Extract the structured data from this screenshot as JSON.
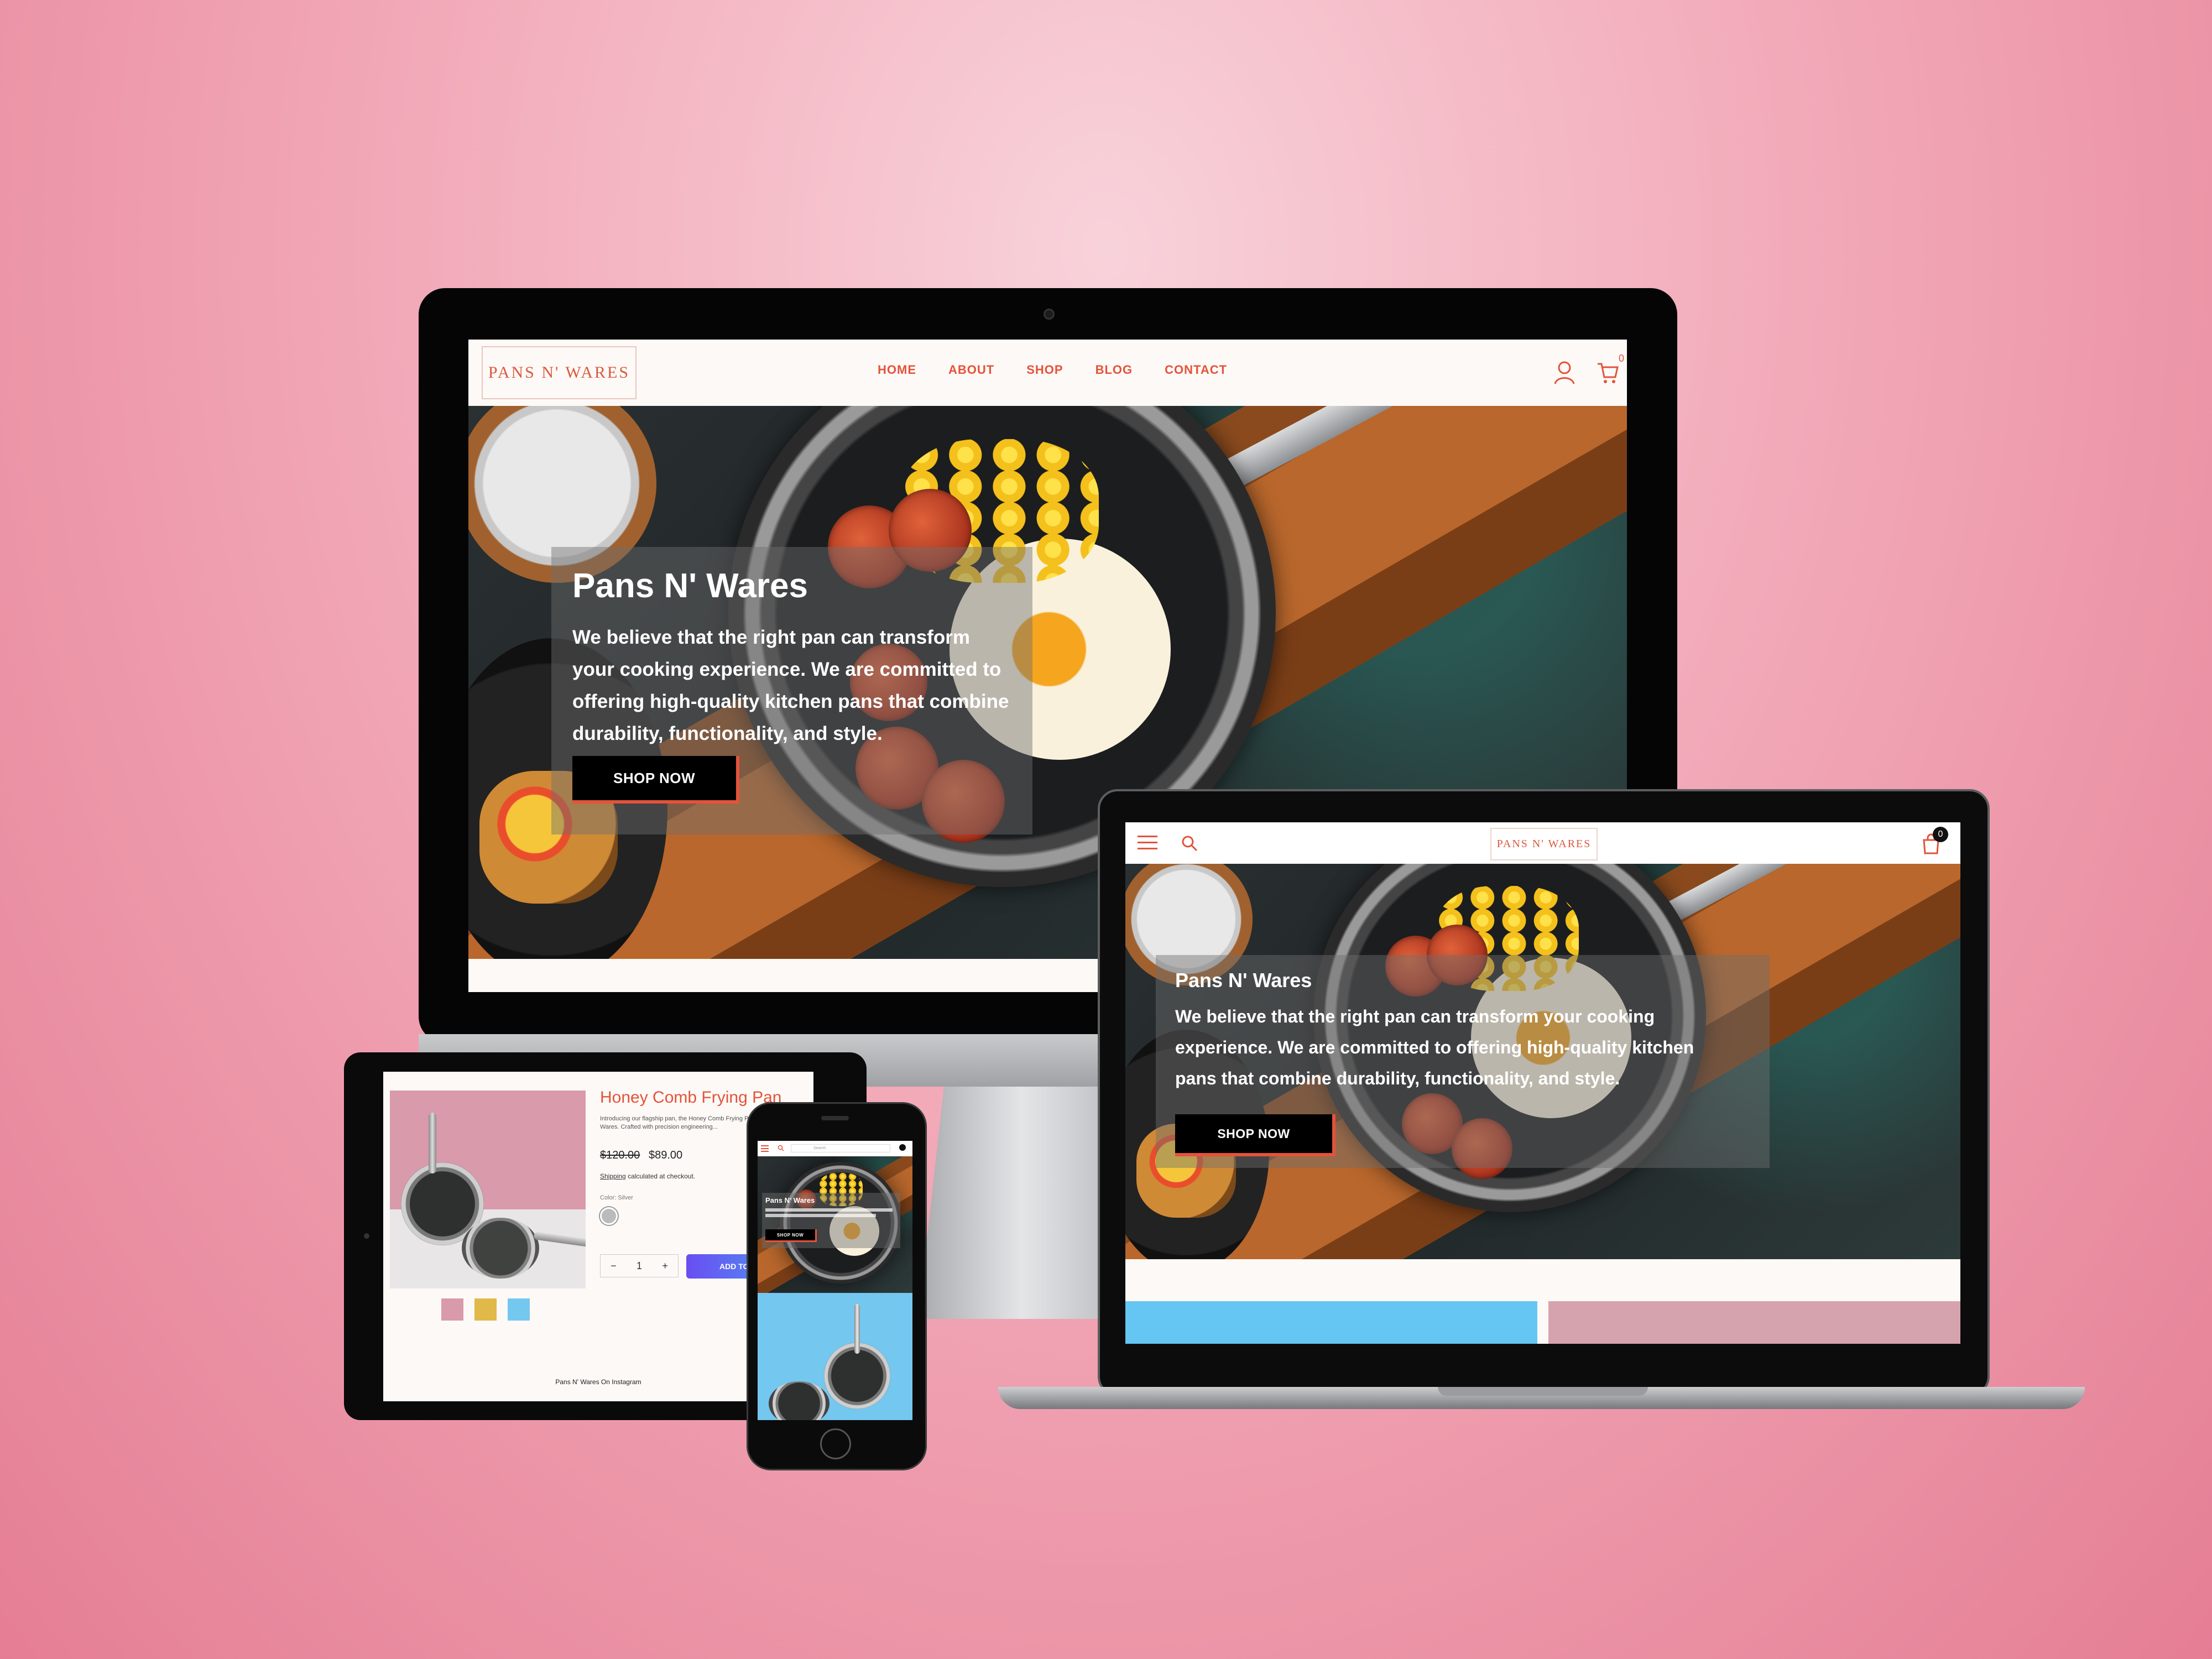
{
  "brand": {
    "logo_text": "PANS N' WARES",
    "accent": "#e3533a"
  },
  "nav": {
    "items": [
      "HOME",
      "ABOUT",
      "SHOP",
      "BLOG",
      "CONTACT"
    ],
    "cart_count": "0"
  },
  "hero": {
    "title": "Pans N' Wares",
    "text": "We believe that the right pan can transform your cooking experience. We are committed to offering high-quality kitchen pans that combine durability, functionality, and style.",
    "button": "SHOP NOW"
  },
  "product": {
    "title": "Honey Comb Frying Pan",
    "description": "Introducing our flagship pan, the Honey Comb Frying Pan by Pans N' Wares. Crafted with precision engineering...",
    "price_old": "$120.00",
    "price": "$89.00",
    "shipping_link": "Shipping",
    "shipping_text": "calculated at checkout.",
    "color_label": "Color: Silver",
    "quantity": "1",
    "add_button": "ADD TO CART",
    "instagram_heading": "Pans N' Wares On Instagram"
  },
  "phone": {
    "search_placeholder": "Search",
    "hero_label": "Pans N' Wares"
  }
}
